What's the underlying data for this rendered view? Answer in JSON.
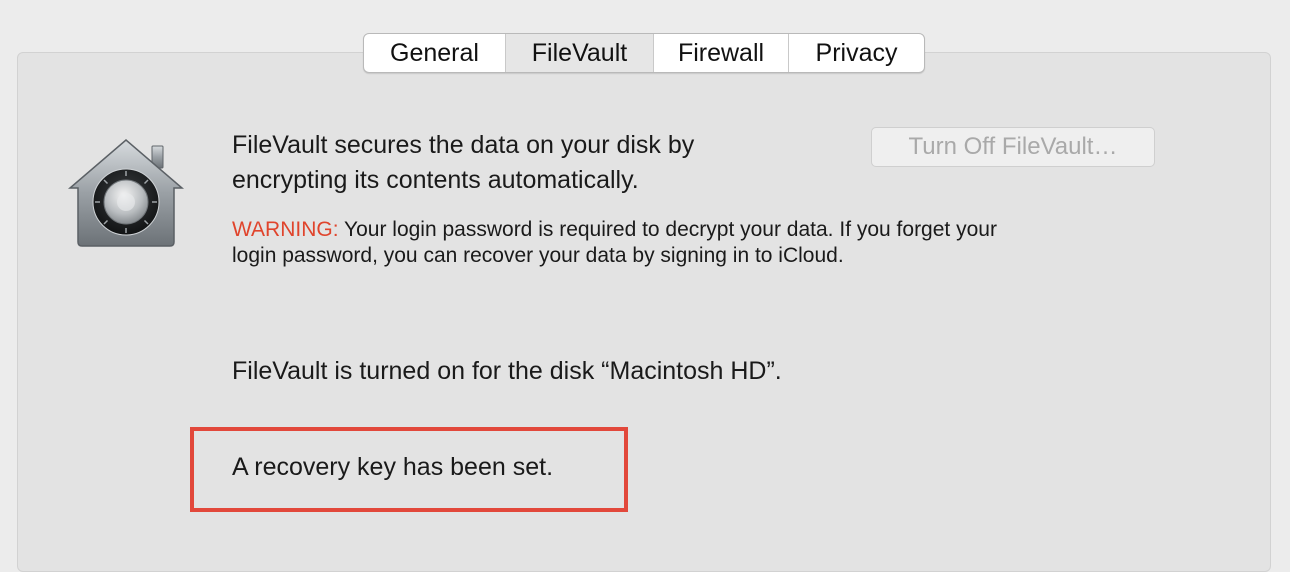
{
  "tabs": [
    {
      "label": "General",
      "selected": false
    },
    {
      "label": "FileVault",
      "selected": true
    },
    {
      "label": "Firewall",
      "selected": false
    },
    {
      "label": "Privacy",
      "selected": false
    }
  ],
  "filevault": {
    "icon": "filevault-safe-icon",
    "description_line1": "FileVault secures the data on your disk by",
    "description_line2": "encrypting its contents automatically.",
    "warning_label": "WARNING:",
    "warning_text_line1": " Your login password is required to decrypt your data. If you forget your",
    "warning_text_line2": "login password, you can recover your data by signing in to iCloud.",
    "turn_off_button": "Turn Off FileVault…",
    "turn_off_enabled": false,
    "status_text": "FileVault is turned on for the disk “Macintosh HD”.",
    "recovery_text": "A recovery key has been set."
  },
  "colors": {
    "warning": "#e0442c",
    "highlight_border": "#e2483b",
    "disabled_text": "#a9a9a9"
  }
}
